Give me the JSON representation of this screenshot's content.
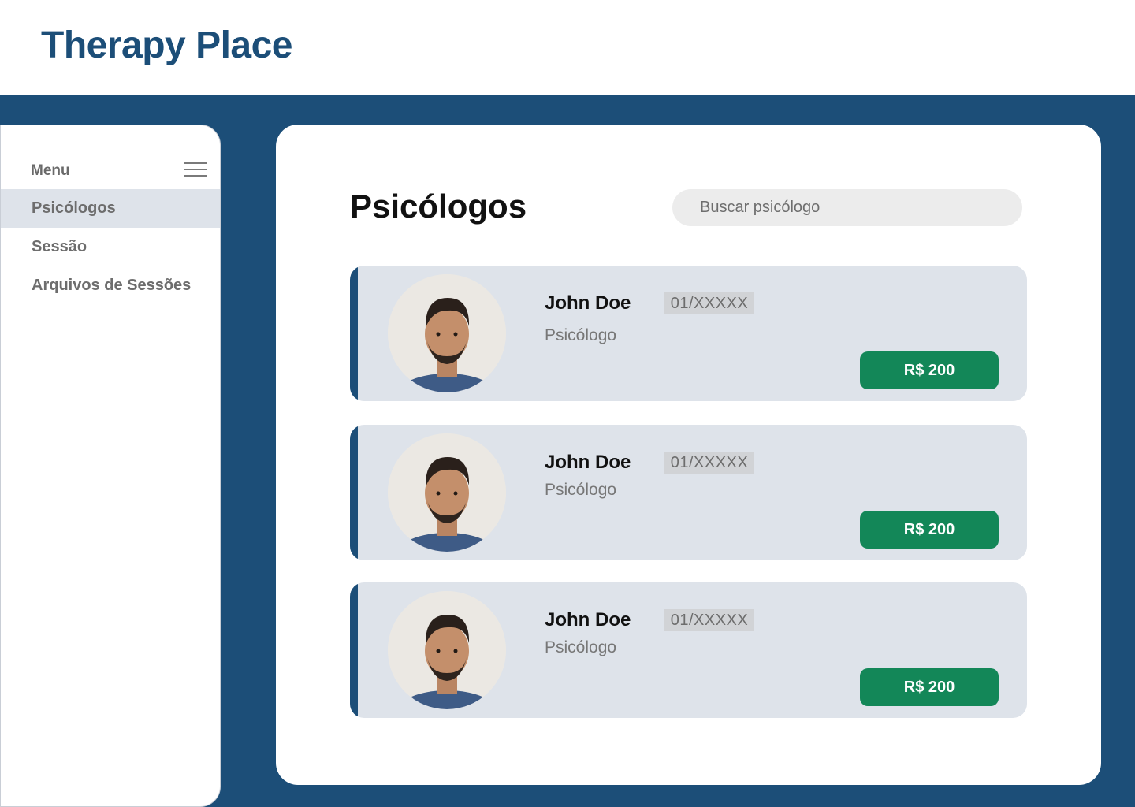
{
  "app": {
    "title": "Therapy Place"
  },
  "sidebar": {
    "menu_label": "Menu",
    "items": [
      {
        "label": "Psicólogos",
        "active": true
      },
      {
        "label": "Sessão",
        "active": false
      },
      {
        "label": "Arquivos de Sessões",
        "active": false
      }
    ]
  },
  "main": {
    "title": "Psicólogos",
    "search": {
      "placeholder": "Buscar psicólogo",
      "value": ""
    },
    "cards": [
      {
        "name": "John Doe",
        "code": "01/XXXXX",
        "role": "Psicólogo",
        "price": "R$ 200"
      },
      {
        "name": "John Doe",
        "code": "01/XXXXX",
        "role": "Psicólogo",
        "price": "R$ 200"
      },
      {
        "name": "John Doe",
        "code": "01/XXXXX",
        "role": "Psicólogo",
        "price": "R$ 200"
      }
    ]
  },
  "colors": {
    "brand": "#1c4e78",
    "card_bg": "#dee3ea",
    "price_button": "#138758"
  },
  "icons": {
    "menu": "hamburger-icon",
    "avatar": "avatar-photo"
  }
}
